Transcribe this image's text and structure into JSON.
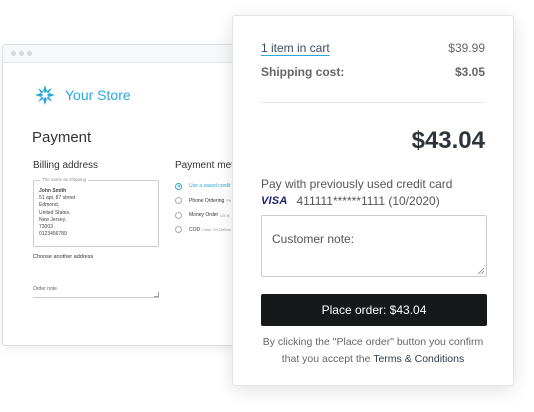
{
  "store": {
    "name": "Your Store",
    "page_title": "Payment",
    "billing": {
      "title": "Billing address",
      "legend": "The same as shipping",
      "lines": [
        "John Smith",
        "51 apt, 87 street",
        "Edmond,",
        "United States,",
        "New Jersey,",
        "73003",
        "0123456789"
      ],
      "choose_another": "Choose another address",
      "order_note_placeholder": "Order note"
    },
    "payment_methods": {
      "title": "Payment meth",
      "items": [
        {
          "label": "Use a saved credit",
          "sub": "",
          "selected": true
        },
        {
          "label": "Phone Ordering",
          "sub": "Ph",
          "selected": false
        },
        {
          "label": "Money Order",
          "sub": "US B",
          "selected": false
        },
        {
          "label": "COD",
          "sub": "Cash On Deliver",
          "selected": false
        }
      ]
    }
  },
  "summary": {
    "items_label": "1 item in cart",
    "items_value": "$39.99",
    "shipping_label": "Shipping cost:",
    "shipping_value": "$3.05",
    "total": "$43.04",
    "pay_label": "Pay with previously used credit card",
    "card_brand": "VISA",
    "card_number": "411111******1111 (10/2020)",
    "note_placeholder": "Customer note:",
    "place_order": "Place order: $43.04",
    "terms_text": "By clicking the \"Place order\" button you confirm that you accept the",
    "terms_link": "Terms & Conditions"
  },
  "colors": {
    "accent": "#2aa8d8",
    "button": "#16181a",
    "visa": "#1a1f71"
  },
  "icons": [
    "store-logo-icon",
    "resize-handle-icon",
    "visa-logo"
  ]
}
